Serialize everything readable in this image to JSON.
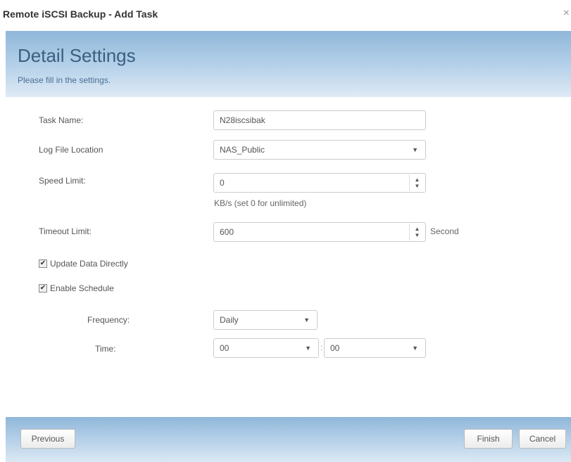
{
  "window": {
    "title": "Remote iSCSI Backup - Add Task",
    "close_glyph": "×"
  },
  "header": {
    "title": "Detail Settings",
    "subtitle": "Please fill in the settings."
  },
  "form": {
    "task_name": {
      "label": "Task Name:",
      "value": "N28iscsibak"
    },
    "log_file_location": {
      "label": "Log File Location",
      "value": "NAS_Public"
    },
    "speed_limit": {
      "label": "Speed Limit:",
      "value": "0",
      "hint": "KB/s (set 0 for unlimited)"
    },
    "timeout_limit": {
      "label": "Timeout Limit:",
      "value": "600",
      "unit": "Second"
    },
    "update_data_directly": {
      "label": "Update Data Directly",
      "checked": true
    },
    "enable_schedule": {
      "label": "Enable Schedule",
      "checked": true
    },
    "frequency": {
      "label": "Frequency:",
      "value": "Daily"
    },
    "time": {
      "label": "Time:",
      "hour": "00",
      "minute": "00",
      "separator": ":"
    }
  },
  "footer": {
    "previous_label": "Previous",
    "finish_label": "Finish",
    "cancel_label": "Cancel"
  },
  "icons": {
    "dropdown": "▼",
    "spin_up": "▲",
    "spin_down": "▼",
    "check": "✔"
  },
  "colors": {
    "header_blue": "#8fb7d9",
    "title_text": "#3a5f80"
  }
}
